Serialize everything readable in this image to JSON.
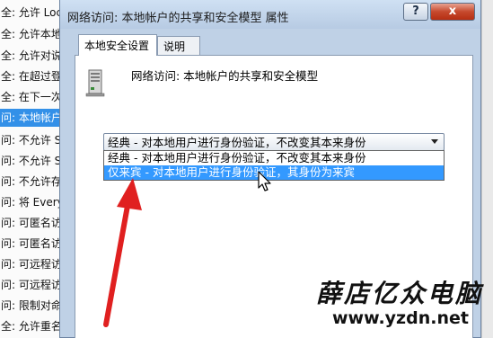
{
  "background_list": {
    "rows": [
      "全: 允许 Loc",
      "全: 允许本地",
      "全: 允许对说",
      "全: 在超过登",
      "全: 在下一次",
      "问: 本地帐户",
      "问: 不允许 S",
      "问: 不允许 S",
      "问: 不允许存",
      "问: 将 Every",
      "问: 可匿名访",
      "问: 可匿名访",
      "问: 可远程访",
      "问: 可远程访",
      "问: 限制对命",
      "全: 允许重名"
    ],
    "selected_index": 5
  },
  "dialog": {
    "title": "网络访问: 本地帐户的共享和安全模型 属性",
    "help_label": "?",
    "close_label": "x",
    "tabs": [
      "本地安全设置",
      "说明"
    ],
    "policy_title": "网络访问: 本地帐户的共享和安全模型",
    "combo_value": "经典 - 对本地用户进行身份验证，不改变其本来身份",
    "options": [
      "经典 - 对本地用户进行身份验证，不改变其本来身份",
      "仅来宾 - 对本地用户进行身份验证，其身份为来宾"
    ],
    "highlighted_option": 1
  },
  "watermark": {
    "name": "薛店亿众电脑",
    "url": "www.yzdn.net"
  },
  "colors": {
    "selection": "#3399ff",
    "arrow": "#e02020",
    "close_button": "#c6492d"
  }
}
